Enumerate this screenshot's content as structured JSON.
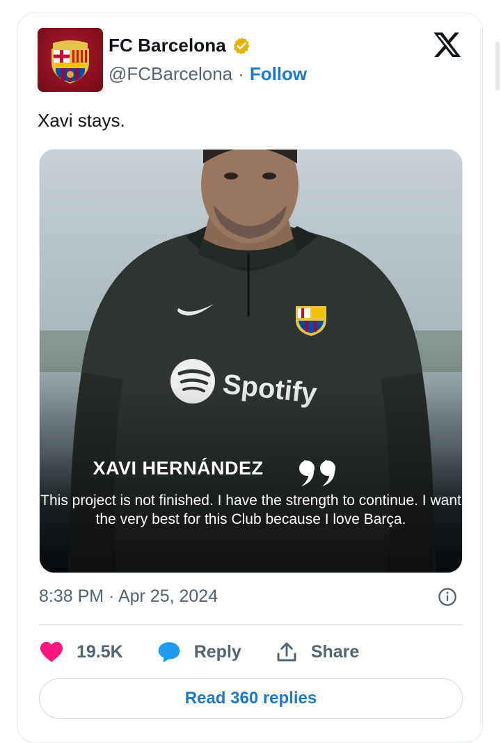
{
  "account": {
    "display_name": "FC Barcelona",
    "handle": "@FCBarcelona",
    "separator": "·",
    "follow_label": "Follow",
    "verified_badge_color": "#e8b300",
    "avatar_icon": "fc-barcelona-crest-icon"
  },
  "tweet": {
    "text": "Xavi stays.",
    "timestamp": "8:38 PM · Apr 25, 2024"
  },
  "media": {
    "quote_name": "XAVI HERNÁNDEZ",
    "quote_text": "This project is not finished. I have the strength to continue. I want the very best for this Club because I love Barça.",
    "shirt_brand": "Spotify"
  },
  "actions": {
    "likes": "19.5K",
    "reply_label": "Reply",
    "share_label": "Share"
  },
  "read_replies_label": "Read 360 replies",
  "colors": {
    "like": "#f91880",
    "reply": "#1d9bf0",
    "link": "#1d78c9",
    "muted": "#536471"
  }
}
